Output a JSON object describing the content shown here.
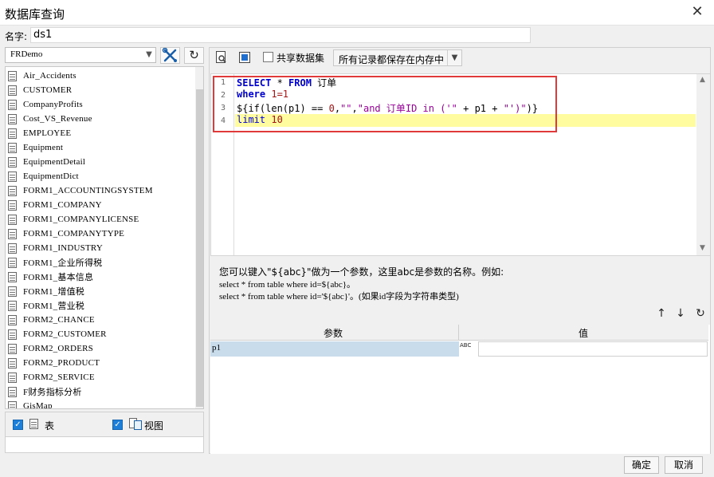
{
  "window": {
    "title": "数据库查询",
    "close_glyph": "✕"
  },
  "name_field": {
    "label": "名字:",
    "value": "ds1"
  },
  "connection": {
    "selected": "FRDemo"
  },
  "tables": [
    "Air_Accidents",
    "CUSTOMER",
    "CompanyProfits",
    "Cost_VS_Revenue",
    "EMPLOYEE",
    "Equipment",
    "EquipmentDetail",
    "EquipmentDict",
    "FORM1_ACCOUNTINGSYSTEM",
    "FORM1_COMPANY",
    "FORM1_COMPANYLICENSE",
    "FORM1_COMPANYTYPE",
    "FORM1_INDUSTRY",
    "FORM1_企业所得税",
    "FORM1_基本信息",
    "FORM1_增值税",
    "FORM1_营业税",
    "FORM2_CHANCE",
    "FORM2_CUSTOMER",
    "FORM2_ORDERS",
    "FORM2_PRODUCT",
    "FORM2_SERVICE",
    "F财务指标分析",
    "GisMap"
  ],
  "options": {
    "table_label": "表",
    "view_label": "视图"
  },
  "toolbar": {
    "share_label": "共享数据集",
    "store_option": "所有记录都保存在内存中"
  },
  "sql": {
    "line_numbers": [
      "1",
      "2",
      "3",
      "4"
    ],
    "l1_kw1": "SELECT",
    "l1_star": " * ",
    "l1_kw2": "FROM",
    "l1_rest": " 订单",
    "l2_kw": "where",
    "l2_rest": " 1=1",
    "l3_a": "${if(len(p1) == ",
    "l3_num": "0",
    "l3_b": ",",
    "l3_str1": "\"\"",
    "l3_c": ",",
    "l3_str2": "\"and 订单ID in ('\"",
    "l3_d": " + p1 + ",
    "l3_str3": "\"')\"",
    "l3_e": ")}",
    "l4_kw": "limit",
    "l4_num": " 10"
  },
  "hints": {
    "line1": "您可以键入\"${abc}\"做为一个参数，这里abc是参数的名称。例如:",
    "line2": "select * from table where id=${abc}。",
    "line3": "select * from table where id='${abc}'。(如果id字段为字符串类型)"
  },
  "param_table": {
    "col_name": "参数",
    "col_value": "值",
    "rows": [
      {
        "name": "p1",
        "value": "",
        "type_icon": "ABC"
      }
    ]
  },
  "buttons": {
    "ok": "确定",
    "cancel": "取消"
  }
}
